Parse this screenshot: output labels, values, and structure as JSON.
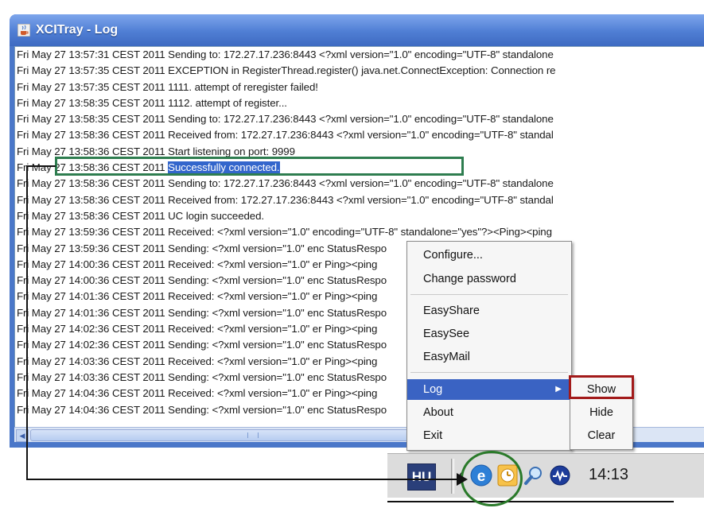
{
  "window": {
    "title": "XCITray - Log",
    "icon": "java-cup-icon"
  },
  "log": {
    "lines": [
      {
        "date": "Fri May 27 13:57:31 CEST 2011",
        "message": "Sending to: 172.27.17.236:8443 <?xml version=\"1.0\" encoding=\"UTF-8\" standalone"
      },
      {
        "date": "Fri May 27 13:57:35 CEST 2011",
        "message": "EXCEPTION in RegisterThread.register() java.net.ConnectException: Connection re"
      },
      {
        "date": "Fri May 27 13:57:35 CEST 2011",
        "message": "1111. attempt of reregister failed!"
      },
      {
        "date": "Fri May 27 13:58:35 CEST 2011",
        "message": "1112. attempt of register..."
      },
      {
        "date": "Fri May 27 13:58:35 CEST 2011",
        "message": "Sending to: 172.27.17.236:8443 <?xml version=\"1.0\" encoding=\"UTF-8\" standalone"
      },
      {
        "date": "Fri May 27 13:58:36 CEST 2011",
        "message": "Received from: 172.27.17.236:8443 <?xml version=\"1.0\" encoding=\"UTF-8\" standal"
      },
      {
        "date": "Fri May 27 13:58:36 CEST 2011",
        "message": "Start listening on port: 9999"
      },
      {
        "date": "Fri May 27 13:58:36 CEST 2011",
        "message": "Successfully connected."
      },
      {
        "date": "Fri May 27 13:58:36 CEST 2011",
        "message": "Sending to: 172.27.17.236:8443 <?xml version=\"1.0\" encoding=\"UTF-8\" standalone"
      },
      {
        "date": "Fri May 27 13:58:36 CEST 2011",
        "message": "Received from: 172.27.17.236:8443 <?xml version=\"1.0\" encoding=\"UTF-8\" standal"
      },
      {
        "date": "Fri May 27 13:58:36 CEST 2011",
        "message": "UC login succeeded."
      },
      {
        "date": "Fri May 27 13:59:36 CEST 2011",
        "message": "Received: <?xml version=\"1.0\" encoding=\"UTF-8\" standalone=\"yes\"?><Ping><ping"
      },
      {
        "date": "Fri May 27 13:59:36 CEST 2011",
        "message": "Sending: <?xml version=\"1.0\" enc                                    StatusRespo"
      },
      {
        "date": "Fri May 27 14:00:36 CEST 2011",
        "message": "Received: <?xml version=\"1.0\" er                                   Ping><ping"
      },
      {
        "date": "Fri May 27 14:00:36 CEST 2011",
        "message": "Sending: <?xml version=\"1.0\" enc                                    StatusRespo"
      },
      {
        "date": "Fri May 27 14:01:36 CEST 2011",
        "message": "Received: <?xml version=\"1.0\" er                                   Ping><ping"
      },
      {
        "date": "Fri May 27 14:01:36 CEST 2011",
        "message": "Sending: <?xml version=\"1.0\" enc                                    StatusRespo"
      },
      {
        "date": "Fri May 27 14:02:36 CEST 2011",
        "message": "Received: <?xml version=\"1.0\" er                                   Ping><ping"
      },
      {
        "date": "Fri May 27 14:02:36 CEST 2011",
        "message": "Sending: <?xml version=\"1.0\" enc                                    StatusRespo"
      },
      {
        "date": "Fri May 27 14:03:36 CEST 2011",
        "message": "Received: <?xml version=\"1.0\" er                                   Ping><ping"
      },
      {
        "date": "Fri May 27 14:03:36 CEST 2011",
        "message": "Sending: <?xml version=\"1.0\" enc                                    StatusRespo"
      },
      {
        "date": "Fri May 27 14:04:36 CEST 2011",
        "message": "Received: <?xml version=\"1.0\" er                                   Ping><ping"
      },
      {
        "date": "Fri May 27 14:04:36 CEST 2011",
        "message": "Sending: <?xml version=\"1.0\" enc                                    StatusRespo"
      }
    ],
    "highlighted_line": 7
  },
  "context_menu": {
    "items": [
      "Configure...",
      "Change password",
      "EasyShare",
      "EasySee",
      "EasyMail",
      "Log",
      "About",
      "Exit"
    ],
    "active_item": "Log"
  },
  "submenu": {
    "items": [
      "Show",
      "Hide",
      "Clear"
    ]
  },
  "taskbar": {
    "app_button": "HU",
    "tray_icons": [
      "estos-e-icon",
      "clock-tray-icon",
      "search-tray-icon",
      "network-tray-icon"
    ],
    "clock": "14:13"
  },
  "colors": {
    "highlight": "#3366cc",
    "menu_active": "#3a63c3",
    "annotation_green": "#2e7d4f",
    "annotation_red": "#a21a1a"
  }
}
